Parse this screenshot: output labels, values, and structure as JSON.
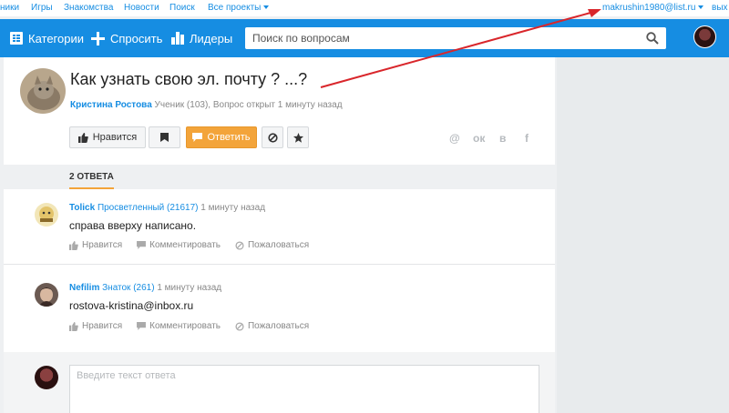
{
  "portal": {
    "links": [
      "ники",
      "Игры",
      "Знакомства",
      "Новости",
      "Поиск"
    ],
    "all_projects": "Все проекты",
    "user_email": "makrushin1980@list.ru",
    "logout": "вых"
  },
  "header": {
    "categories": "Категории",
    "ask": "Спросить",
    "leaders": "Лидеры",
    "search_placeholder": "Поиск по вопросам"
  },
  "question": {
    "title": "Как узнать свою эл. почту ? ...?",
    "author": "Кристина Ростова",
    "author_info": "Ученик (103), Вопрос открыт 1 минуту назад",
    "like_label": "Нравится",
    "answer_label": "Ответить",
    "share_icons": [
      "@",
      "ок",
      "в",
      "f"
    ]
  },
  "answers_tab": "2 ОТВЕТА",
  "answers": [
    {
      "name": "Tolick",
      "rank": "Просветленный (21617)",
      "time": "1 минуту назад",
      "text": "справа вверху написано."
    },
    {
      "name": "Nefilim",
      "rank": "Знаток (261)",
      "time": "1 минуту назад",
      "text": "rostova-kristina@inbox.ru"
    }
  ],
  "answer_actions": {
    "like": "Нравится",
    "comment": "Комментировать",
    "report": "Пожаловаться"
  },
  "reply": {
    "placeholder": "Введите текст ответа"
  },
  "colors": {
    "brand_blue": "#168de2",
    "answer_orange": "#f3a43a",
    "arrow_red": "#d9262b"
  }
}
